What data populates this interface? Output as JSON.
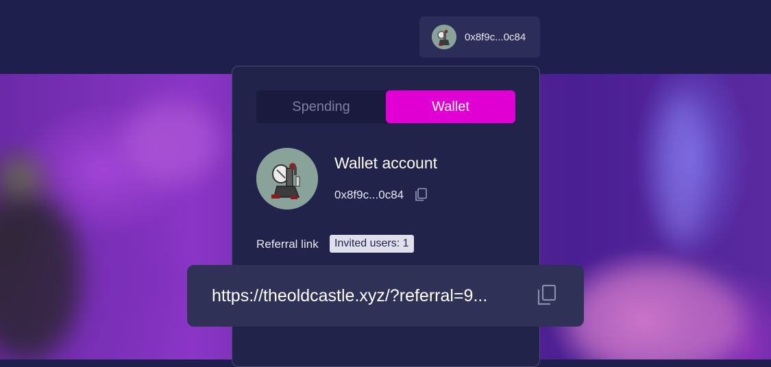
{
  "header": {
    "wallet_chip": {
      "address": "0x8f9c...0c84",
      "avatar_icon": "knight-avatar-icon"
    }
  },
  "wallet_panel": {
    "tabs": [
      {
        "label": "Spending",
        "active": false
      },
      {
        "label": "Wallet",
        "active": true
      }
    ],
    "account": {
      "title": "Wallet account",
      "address": "0x8f9c...0c84",
      "avatar_icon": "knight-avatar-icon",
      "copy_icon": "copy-icon"
    },
    "referral": {
      "label": "Referral link",
      "invited_badge": "Invited users: 1",
      "url": "https://theoldcastle.xyz/?referral=9...",
      "copy_icon": "copy-icon"
    }
  },
  "colors": {
    "header_bg": "#1e1f4d",
    "panel_bg": "#22234a",
    "accent": "#e100d4",
    "referral_box_bg": "#2f3157"
  }
}
